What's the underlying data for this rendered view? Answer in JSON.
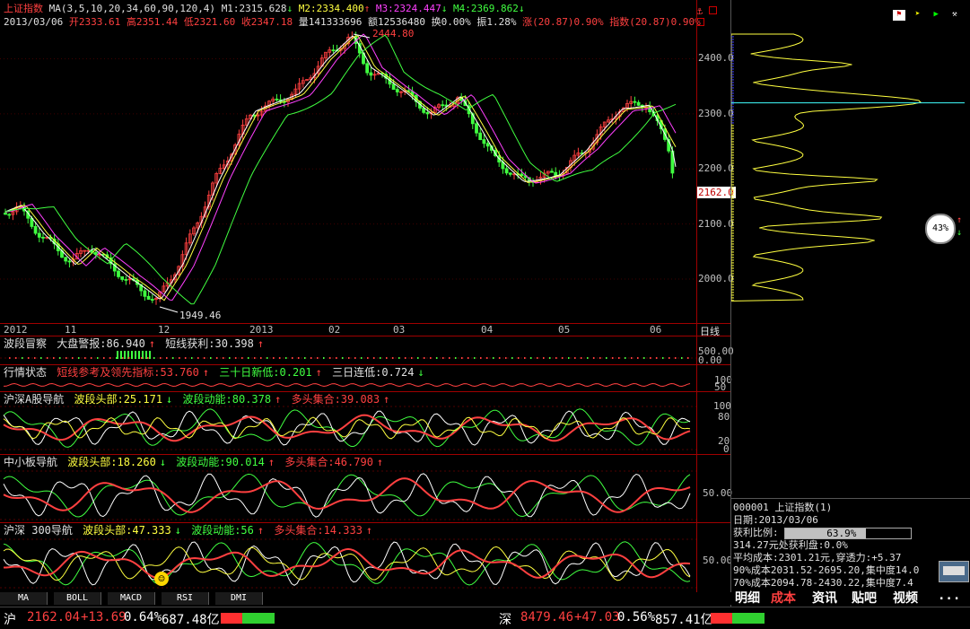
{
  "main": {
    "index_name": "上证指数",
    "ma_label": "MA(3,5,10,20,34,60,90,120,4)",
    "m1": "M1:2315.628",
    "m2": "M2:2334.400",
    "m3": "M3:2324.447",
    "m4": "M4:2369.862",
    "date": "2013/03/06",
    "open": "开2333.61",
    "high": "高2351.44",
    "low": "低2321.60",
    "close": "收2347.18",
    "volume": "量141333696",
    "amount": "额12536480",
    "turnover": "换0.00%",
    "amplitude": "振1.28%",
    "change": "涨(20.87)0.90%",
    "index_change": "指数(20.87)0.90%",
    "peak_label": "2444.80",
    "trough_label": "1949.46",
    "current_price_tag": "2162.0",
    "price_axis": [
      "2400.0",
      "2300.0",
      "2200.0",
      "2100.0",
      "2000.0"
    ],
    "time_axis": [
      "2012",
      "11",
      "12",
      "2013",
      "02",
      "03",
      "04",
      "05",
      "06"
    ],
    "period": "日线"
  },
  "panels": {
    "p1": {
      "name": "波段冒察",
      "a": "大盘警报:86.940",
      "b": "短线获利:30.398",
      "axis": [
        "500.00",
        "0.00"
      ]
    },
    "p2": {
      "name": "行情状态",
      "a": "短线参考及领先指标:53.760",
      "b": "三十日新低:0.201",
      "c": "三日连低:0.724",
      "axis": [
        "100",
        "50"
      ]
    },
    "p3": {
      "name": "沪深A股导航",
      "a": "波段头部:25.171",
      "b": "波段动能:80.378",
      "c": "多头集合:39.083",
      "axis": [
        "100",
        "80",
        "20",
        "0"
      ]
    },
    "p4": {
      "name": "中小板导航",
      "a": "波段头部:18.260",
      "b": "波段动能:90.014",
      "c": "多头集合:46.790",
      "axis": [
        "50.00"
      ]
    },
    "p5": {
      "name": "沪深 300导航",
      "a": "波段头部:47.333",
      "b": "波段动能:56",
      "c": "多头集合:14.333",
      "axis": [
        "50.00"
      ]
    }
  },
  "bottom_tabs": [
    "MA",
    "BOLL",
    "MACD",
    "RSI",
    "DMI"
  ],
  "right": {
    "percent": "43%",
    "code_line": "000001 上证指数(1)",
    "date_line": "日期:2013/03/06",
    "profit_label": "获利比例:",
    "profit_value": "63.9%",
    "profit_fraction": 0.639,
    "line1": "314.27元处获利盘:0.0%",
    "line2": "平均成本:2301.21元,穿透力:+5.37",
    "line3": "90%成本2031.52-2695.20,集中度14.0",
    "line4": "70%成本2094.78-2430.22,集中度7.4",
    "tabs": [
      "明细",
      "成本",
      "资讯",
      "贴吧",
      "视频",
      "..."
    ]
  },
  "status": {
    "sh_label": "沪",
    "sh_value": "2162.04",
    "sh_change": "+13.69",
    "sh_pct": "0.64%",
    "sh_amount": "687.48亿",
    "sz_label": "深",
    "sz_value": "8479.46",
    "sz_change": "+47.03",
    "sz_pct": "0.56%",
    "sz_amount": "857.41亿"
  },
  "colors": {
    "up": "#ff4040",
    "down": "#40ff40",
    "ma1": "#ffffff",
    "ma2": "#ffff40",
    "ma3": "#ff40ff",
    "ma4": "#40ff40",
    "grid": "#a00000"
  }
}
